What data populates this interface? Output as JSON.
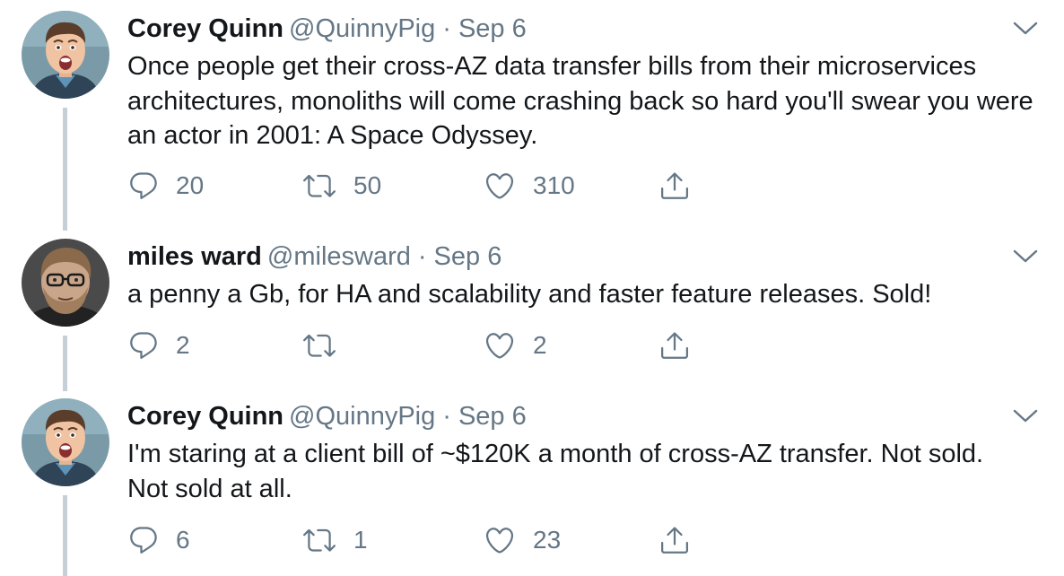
{
  "tweets": [
    {
      "name": "Corey Quinn",
      "handle": "@QuinnyPig",
      "separator": "·",
      "date": "Sep 6",
      "text": "Once people get their cross-AZ data transfer bills from their microservices architectures, monoliths will come crashing back so hard you'll swear you were an actor in 2001: A Space Odyssey.",
      "replies": "20",
      "retweets": "50",
      "likes": "310",
      "avatar_icon": "avatar-corey-quinn"
    },
    {
      "name": "miles ward",
      "handle": "@milesward",
      "separator": "·",
      "date": "Sep 6",
      "text": "a penny a Gb, for HA and scalability and faster feature releases. Sold!",
      "replies": "2",
      "retweets": "",
      "likes": "2",
      "avatar_icon": "avatar-miles-ward"
    },
    {
      "name": "Corey Quinn",
      "handle": "@QuinnyPig",
      "separator": "·",
      "date": "Sep 6",
      "text": "I'm staring at a client bill of ~$120K a month of cross-AZ transfer. Not sold. Not sold at all.",
      "replies": "6",
      "retweets": "1",
      "likes": "23",
      "avatar_icon": "avatar-corey-quinn"
    }
  ],
  "icons": {
    "reply": "reply-icon",
    "retweet": "retweet-icon",
    "like": "heart-icon",
    "share": "share-icon",
    "caret": "chevron-down-icon"
  },
  "colors": {
    "text": "#14171a",
    "muted": "#657786",
    "thread_line": "#c4cfd6"
  }
}
